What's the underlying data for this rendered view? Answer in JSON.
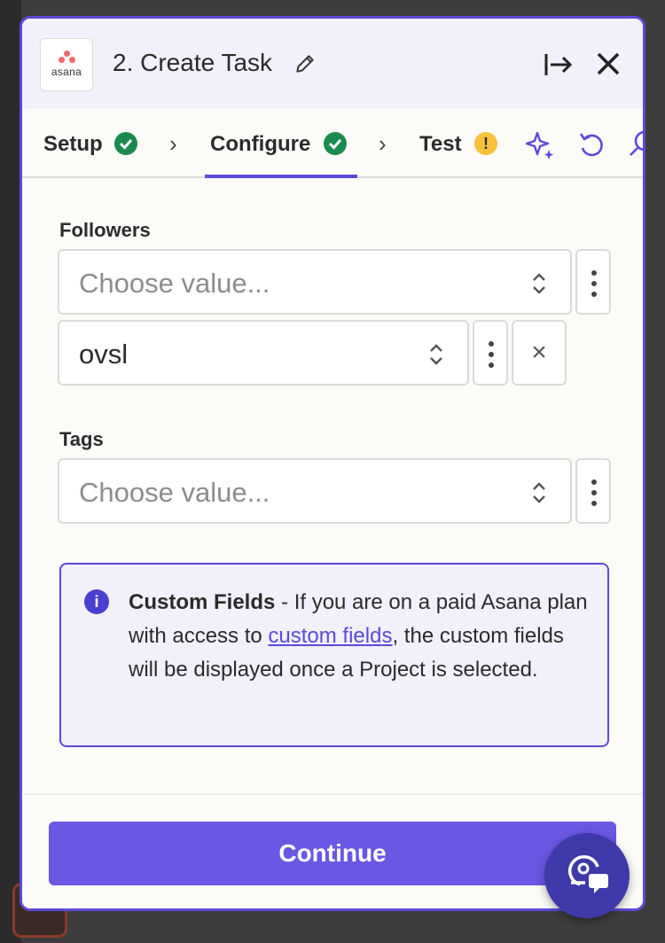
{
  "header": {
    "app_logo_text": "asana",
    "title": "2. Create Task"
  },
  "tabs": [
    {
      "label": "Setup",
      "status": "complete"
    },
    {
      "label": "Configure",
      "status": "complete"
    },
    {
      "label": "Test",
      "status": "warning",
      "status_glyph": "!"
    }
  ],
  "fields": {
    "followers": {
      "label": "Followers",
      "placeholder": "Choose value...",
      "values": [
        "ovsl"
      ]
    },
    "tags": {
      "label": "Tags",
      "placeholder": "Choose value..."
    }
  },
  "info": {
    "icon_glyph": "i",
    "bold": "Custom Fields",
    "text_before_link": " - If you are on a paid Asana plan with access to ",
    "link_text": "custom fields",
    "text_after_link": ", the custom fields will be displayed once a Project is selected."
  },
  "footer": {
    "continue_label": "Continue"
  },
  "remove_glyph": "×",
  "colors": {
    "accent": "#5b4ad9",
    "success": "#1b8a4e",
    "warning": "#f7c23a",
    "asana": "#f06a6a"
  },
  "icons": [
    "edit-icon",
    "collapse-panel-icon",
    "close-icon",
    "check-icon",
    "warning-icon",
    "sparkle-icon",
    "undo-icon",
    "search-icon",
    "up-down-icon",
    "kebab-icon",
    "info-icon",
    "chat-support-icon"
  ]
}
